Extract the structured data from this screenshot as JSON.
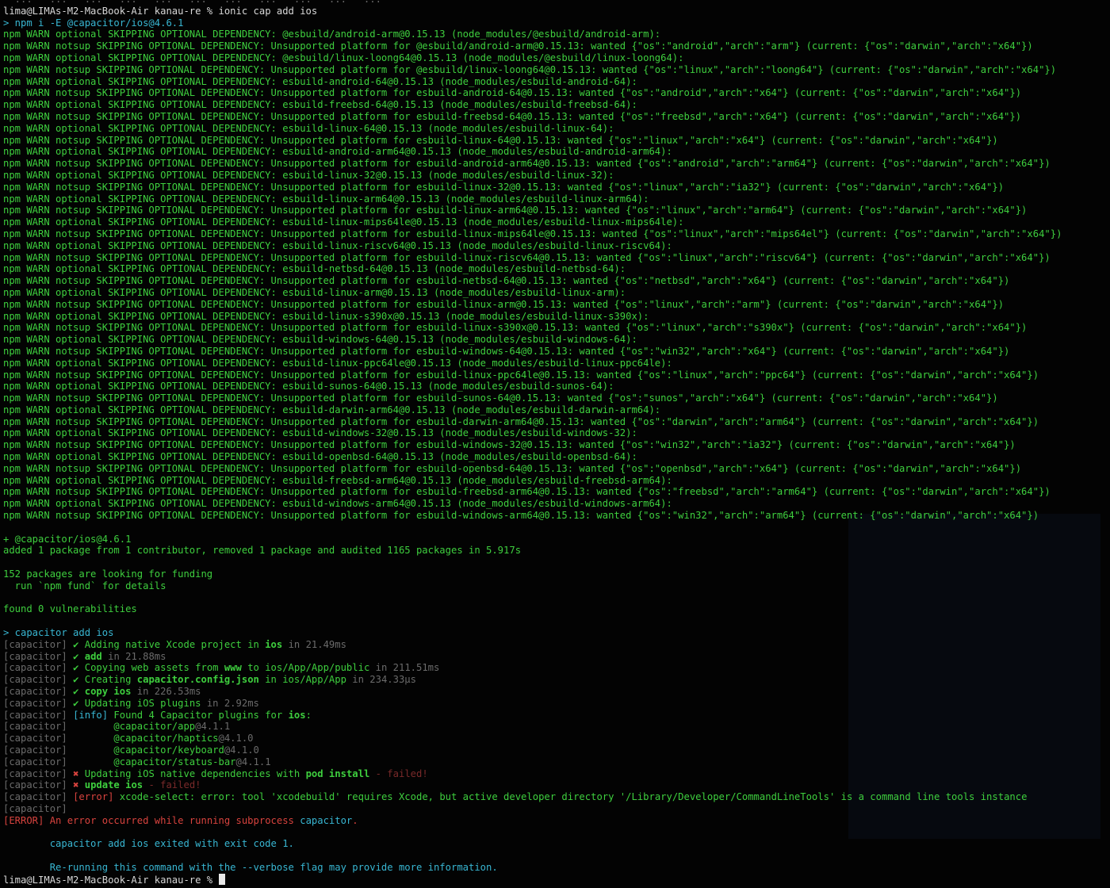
{
  "colors": {
    "background": "#030303",
    "npm_output_green": "#3ecf3e",
    "plain_text": "#d8d8d8",
    "dim_prefix": "#6b6b6b",
    "highlight_cyan": "#38b6d2",
    "error_red": "#d8433e"
  },
  "top": {
    "partial": "  ...   ...   ...   ...   ...   ...   ...   ...   ...   ...   ...",
    "prompt": "lima@LIMAs-M2-MacBook-Air kanau-re % ",
    "command": "ionic cap add ios",
    "npm_cmd": "> npm i -E @capacitor/ios@4.6.1"
  },
  "npm_warnings": [
    "npm WARN optional SKIPPING OPTIONAL DEPENDENCY: @esbuild/android-arm@0.15.13 (node_modules/@esbuild/android-arm):",
    "npm WARN notsup SKIPPING OPTIONAL DEPENDENCY: Unsupported platform for @esbuild/android-arm@0.15.13: wanted {\"os\":\"android\",\"arch\":\"arm\"} (current: {\"os\":\"darwin\",\"arch\":\"x64\"})",
    "npm WARN optional SKIPPING OPTIONAL DEPENDENCY: @esbuild/linux-loong64@0.15.13 (node_modules/@esbuild/linux-loong64):",
    "npm WARN notsup SKIPPING OPTIONAL DEPENDENCY: Unsupported platform for @esbuild/linux-loong64@0.15.13: wanted {\"os\":\"linux\",\"arch\":\"loong64\"} (current: {\"os\":\"darwin\",\"arch\":\"x64\"})",
    "npm WARN optional SKIPPING OPTIONAL DEPENDENCY: esbuild-android-64@0.15.13 (node_modules/esbuild-android-64):",
    "npm WARN notsup SKIPPING OPTIONAL DEPENDENCY: Unsupported platform for esbuild-android-64@0.15.13: wanted {\"os\":\"android\",\"arch\":\"x64\"} (current: {\"os\":\"darwin\",\"arch\":\"x64\"})",
    "npm WARN optional SKIPPING OPTIONAL DEPENDENCY: esbuild-freebsd-64@0.15.13 (node_modules/esbuild-freebsd-64):",
    "npm WARN notsup SKIPPING OPTIONAL DEPENDENCY: Unsupported platform for esbuild-freebsd-64@0.15.13: wanted {\"os\":\"freebsd\",\"arch\":\"x64\"} (current: {\"os\":\"darwin\",\"arch\":\"x64\"})",
    "npm WARN optional SKIPPING OPTIONAL DEPENDENCY: esbuild-linux-64@0.15.13 (node_modules/esbuild-linux-64):",
    "npm WARN notsup SKIPPING OPTIONAL DEPENDENCY: Unsupported platform for esbuild-linux-64@0.15.13: wanted {\"os\":\"linux\",\"arch\":\"x64\"} (current: {\"os\":\"darwin\",\"arch\":\"x64\"})",
    "npm WARN optional SKIPPING OPTIONAL DEPENDENCY: esbuild-android-arm64@0.15.13 (node_modules/esbuild-android-arm64):",
    "npm WARN notsup SKIPPING OPTIONAL DEPENDENCY: Unsupported platform for esbuild-android-arm64@0.15.13: wanted {\"os\":\"android\",\"arch\":\"arm64\"} (current: {\"os\":\"darwin\",\"arch\":\"x64\"})",
    "npm WARN optional SKIPPING OPTIONAL DEPENDENCY: esbuild-linux-32@0.15.13 (node_modules/esbuild-linux-32):",
    "npm WARN notsup SKIPPING OPTIONAL DEPENDENCY: Unsupported platform for esbuild-linux-32@0.15.13: wanted {\"os\":\"linux\",\"arch\":\"ia32\"} (current: {\"os\":\"darwin\",\"arch\":\"x64\"})",
    "npm WARN optional SKIPPING OPTIONAL DEPENDENCY: esbuild-linux-arm64@0.15.13 (node_modules/esbuild-linux-arm64):",
    "npm WARN notsup SKIPPING OPTIONAL DEPENDENCY: Unsupported platform for esbuild-linux-arm64@0.15.13: wanted {\"os\":\"linux\",\"arch\":\"arm64\"} (current: {\"os\":\"darwin\",\"arch\":\"x64\"})",
    "npm WARN optional SKIPPING OPTIONAL DEPENDENCY: esbuild-linux-mips64le@0.15.13 (node_modules/esbuild-linux-mips64le):",
    "npm WARN notsup SKIPPING OPTIONAL DEPENDENCY: Unsupported platform for esbuild-linux-mips64le@0.15.13: wanted {\"os\":\"linux\",\"arch\":\"mips64el\"} (current: {\"os\":\"darwin\",\"arch\":\"x64\"})",
    "npm WARN optional SKIPPING OPTIONAL DEPENDENCY: esbuild-linux-riscv64@0.15.13 (node_modules/esbuild-linux-riscv64):",
    "npm WARN notsup SKIPPING OPTIONAL DEPENDENCY: Unsupported platform for esbuild-linux-riscv64@0.15.13: wanted {\"os\":\"linux\",\"arch\":\"riscv64\"} (current: {\"os\":\"darwin\",\"arch\":\"x64\"})",
    "npm WARN optional SKIPPING OPTIONAL DEPENDENCY: esbuild-netbsd-64@0.15.13 (node_modules/esbuild-netbsd-64):",
    "npm WARN notsup SKIPPING OPTIONAL DEPENDENCY: Unsupported platform for esbuild-netbsd-64@0.15.13: wanted {\"os\":\"netbsd\",\"arch\":\"x64\"} (current: {\"os\":\"darwin\",\"arch\":\"x64\"})",
    "npm WARN optional SKIPPING OPTIONAL DEPENDENCY: esbuild-linux-arm@0.15.13 (node_modules/esbuild-linux-arm):",
    "npm WARN notsup SKIPPING OPTIONAL DEPENDENCY: Unsupported platform for esbuild-linux-arm@0.15.13: wanted {\"os\":\"linux\",\"arch\":\"arm\"} (current: {\"os\":\"darwin\",\"arch\":\"x64\"})",
    "npm WARN optional SKIPPING OPTIONAL DEPENDENCY: esbuild-linux-s390x@0.15.13 (node_modules/esbuild-linux-s390x):",
    "npm WARN notsup SKIPPING OPTIONAL DEPENDENCY: Unsupported platform for esbuild-linux-s390x@0.15.13: wanted {\"os\":\"linux\",\"arch\":\"s390x\"} (current: {\"os\":\"darwin\",\"arch\":\"x64\"})",
    "npm WARN optional SKIPPING OPTIONAL DEPENDENCY: esbuild-windows-64@0.15.13 (node_modules/esbuild-windows-64):",
    "npm WARN notsup SKIPPING OPTIONAL DEPENDENCY: Unsupported platform for esbuild-windows-64@0.15.13: wanted {\"os\":\"win32\",\"arch\":\"x64\"} (current: {\"os\":\"darwin\",\"arch\":\"x64\"})",
    "npm WARN optional SKIPPING OPTIONAL DEPENDENCY: esbuild-linux-ppc64le@0.15.13 (node_modules/esbuild-linux-ppc64le):",
    "npm WARN notsup SKIPPING OPTIONAL DEPENDENCY: Unsupported platform for esbuild-linux-ppc64le@0.15.13: wanted {\"os\":\"linux\",\"arch\":\"ppc64\"} (current: {\"os\":\"darwin\",\"arch\":\"x64\"})",
    "npm WARN optional SKIPPING OPTIONAL DEPENDENCY: esbuild-sunos-64@0.15.13 (node_modules/esbuild-sunos-64):",
    "npm WARN notsup SKIPPING OPTIONAL DEPENDENCY: Unsupported platform for esbuild-sunos-64@0.15.13: wanted {\"os\":\"sunos\",\"arch\":\"x64\"} (current: {\"os\":\"darwin\",\"arch\":\"x64\"})",
    "npm WARN optional SKIPPING OPTIONAL DEPENDENCY: esbuild-darwin-arm64@0.15.13 (node_modules/esbuild-darwin-arm64):",
    "npm WARN notsup SKIPPING OPTIONAL DEPENDENCY: Unsupported platform for esbuild-darwin-arm64@0.15.13: wanted {\"os\":\"darwin\",\"arch\":\"arm64\"} (current: {\"os\":\"darwin\",\"arch\":\"x64\"})",
    "npm WARN optional SKIPPING OPTIONAL DEPENDENCY: esbuild-windows-32@0.15.13 (node_modules/esbuild-windows-32):",
    "npm WARN notsup SKIPPING OPTIONAL DEPENDENCY: Unsupported platform for esbuild-windows-32@0.15.13: wanted {\"os\":\"win32\",\"arch\":\"ia32\"} (current: {\"os\":\"darwin\",\"arch\":\"x64\"})",
    "npm WARN optional SKIPPING OPTIONAL DEPENDENCY: esbuild-openbsd-64@0.15.13 (node_modules/esbuild-openbsd-64):",
    "npm WARN notsup SKIPPING OPTIONAL DEPENDENCY: Unsupported platform for esbuild-openbsd-64@0.15.13: wanted {\"os\":\"openbsd\",\"arch\":\"x64\"} (current: {\"os\":\"darwin\",\"arch\":\"x64\"})",
    "npm WARN optional SKIPPING OPTIONAL DEPENDENCY: esbuild-freebsd-arm64@0.15.13 (node_modules/esbuild-freebsd-arm64):",
    "npm WARN notsup SKIPPING OPTIONAL DEPENDENCY: Unsupported platform for esbuild-freebsd-arm64@0.15.13: wanted {\"os\":\"freebsd\",\"arch\":\"arm64\"} (current: {\"os\":\"darwin\",\"arch\":\"x64\"})",
    "npm WARN optional SKIPPING OPTIONAL DEPENDENCY: esbuild-windows-arm64@0.15.13 (node_modules/esbuild-windows-arm64):",
    "npm WARN notsup SKIPPING OPTIONAL DEPENDENCY: Unsupported platform for esbuild-windows-arm64@0.15.13: wanted {\"os\":\"win32\",\"arch\":\"arm64\"} (current: {\"os\":\"darwin\",\"arch\":\"x64\"})"
  ],
  "npm_summary": {
    "installed": "+ @capacitor/ios@4.6.1",
    "added": "added 1 package from 1 contributor, removed 1 package and audited 1165 packages in 5.917s",
    "funding": "152 packages are looking for funding",
    "fund_hint": "  run `npm fund` for details",
    "vulns": "found 0 vulnerabilities"
  },
  "cap": {
    "cmd": "> capacitor add ios",
    "prefix": "[capacitor]",
    "check": "✔",
    "cross": "✖",
    "native_a": " Adding native Xcode project in ",
    "native_b": "ios",
    "native_t": " in 21.49ms",
    "add_a": "add",
    "add_t": " in 21.88ms",
    "copy_a": " Copying web assets from ",
    "copy_b": "www",
    "copy_c": " to ios/App/App/public",
    "copy_t": " in 211.51ms",
    "cfg_a": " Creating ",
    "cfg_b": "capacitor.config.json",
    "cfg_c": " in ios/App/App",
    "cfg_t": " in 234.33μs",
    "cpios_a": "copy ios",
    "cpios_t": " in 226.53ms",
    "upd_a": " Updating iOS plugins",
    "upd_t": " in 2.92ms",
    "info_tag": "[info]",
    "found_a": " Found 4 Capacitor plugins for ",
    "found_b": "ios",
    "found_c": ":",
    "plugins": [
      {
        "name": "        @capacitor/app",
        "ver": "@4.1.1"
      },
      {
        "name": "        @capacitor/haptics",
        "ver": "@4.1.0"
      },
      {
        "name": "        @capacitor/keyboard",
        "ver": "@4.1.0"
      },
      {
        "name": "        @capacitor/status-bar",
        "ver": "@4.1.1"
      }
    ],
    "dep_a": " Updating iOS native dependencies with ",
    "dep_b": "pod install",
    "dep_t": " - failed!",
    "updios_a": "update ios",
    "updios_t": " - failed!",
    "err_tag": "[error]",
    "err_msg": " xcode-select: error: tool 'xcodebuild' requires Xcode, but active developer directory '/Library/Developer/CommandLineTools' is a command line tools instance"
  },
  "final": {
    "error_tag": "[ERROR]",
    "error_a": " An error occurred while running subprocess ",
    "error_b": "capacitor",
    "error_c": ".",
    "exit_msg": "        capacitor add ios exited with exit code 1.",
    "verbose_msg": "        Re-running this command with the --verbose flag may provide more information.",
    "prompt": "lima@LIMAs-M2-MacBook-Air kanau-re % "
  }
}
